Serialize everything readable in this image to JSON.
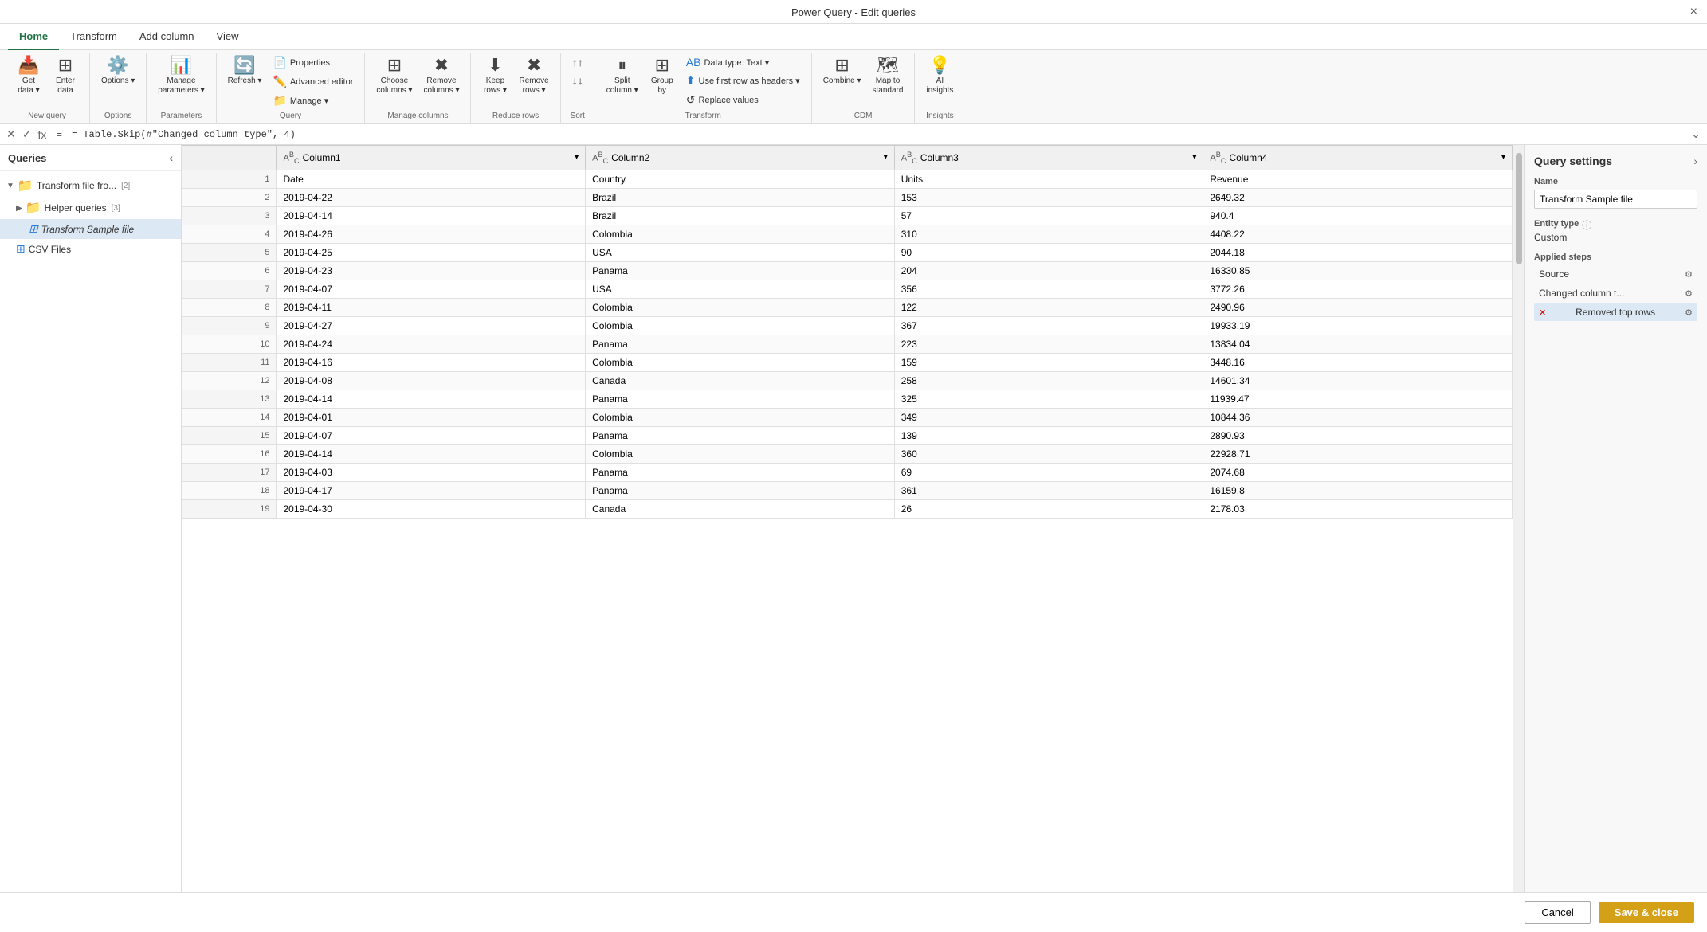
{
  "window": {
    "title": "Power Query - Edit queries",
    "close_label": "×"
  },
  "ribbon": {
    "tabs": [
      {
        "id": "home",
        "label": "Home",
        "active": true
      },
      {
        "id": "transform",
        "label": "Transform"
      },
      {
        "id": "add_column",
        "label": "Add column"
      },
      {
        "id": "view",
        "label": "View"
      }
    ],
    "groups": {
      "new_query": {
        "label": "New query",
        "buttons": [
          {
            "id": "get_data",
            "label": "Get\ndata",
            "icon": "📥"
          },
          {
            "id": "enter_data",
            "label": "Enter\ndata",
            "icon": "📋"
          }
        ]
      },
      "options": {
        "label": "Options",
        "buttons": [
          {
            "id": "options",
            "label": "Options",
            "icon": "⚙️"
          }
        ]
      },
      "parameters": {
        "label": "Parameters",
        "buttons": [
          {
            "id": "manage_parameters",
            "label": "Manage\nparameters",
            "icon": "📊"
          }
        ]
      },
      "query": {
        "label": "Query",
        "small_buttons": [
          {
            "id": "properties",
            "label": "Properties",
            "icon": "📄"
          },
          {
            "id": "advanced_editor",
            "label": "Advanced editor",
            "icon": "✏️"
          },
          {
            "id": "manage",
            "label": "Manage",
            "icon": "📁"
          }
        ],
        "buttons": [
          {
            "id": "refresh",
            "label": "Refresh",
            "icon": "🔄"
          }
        ]
      },
      "manage_columns": {
        "label": "Manage columns",
        "buttons": [
          {
            "id": "choose_columns",
            "label": "Choose\ncolumns",
            "icon": "⊞"
          },
          {
            "id": "remove_columns",
            "label": "Remove\ncolumns",
            "icon": "✖"
          }
        ]
      },
      "reduce_rows": {
        "label": "Reduce rows",
        "buttons": [
          {
            "id": "keep_rows",
            "label": "Keep\nrows",
            "icon": "⬇"
          },
          {
            "id": "remove_rows",
            "label": "Remove\nrows",
            "icon": "✖"
          }
        ]
      },
      "sort": {
        "label": "Sort",
        "buttons": [
          {
            "id": "sort_asc",
            "label": "",
            "icon": "↑"
          },
          {
            "id": "sort_desc",
            "label": "",
            "icon": "↓"
          }
        ]
      },
      "transform": {
        "label": "Transform",
        "buttons": [
          {
            "id": "split_column",
            "label": "Split\ncolumn",
            "icon": "⏸"
          },
          {
            "id": "group_by",
            "label": "Group\nby",
            "icon": "⊞"
          }
        ],
        "small_buttons": [
          {
            "id": "data_type",
            "label": "Data type: Text",
            "icon": "AB"
          },
          {
            "id": "use_first_row",
            "label": "Use first row as headers",
            "icon": "⬆"
          },
          {
            "id": "replace_values",
            "label": "Replace values",
            "icon": "↺"
          }
        ]
      },
      "cdm": {
        "label": "CDM",
        "buttons": [
          {
            "id": "combine",
            "label": "Combine",
            "icon": "⊞"
          },
          {
            "id": "map_to_standard",
            "label": "Map to\nstandard",
            "icon": "🗺"
          }
        ]
      },
      "insights": {
        "label": "Insights",
        "buttons": [
          {
            "id": "ai_insights",
            "label": "AI\ninsights",
            "icon": "💡"
          }
        ]
      }
    }
  },
  "formula_bar": {
    "formula": "= Table.Skip(#\"Changed column type\", 4)",
    "placeholder": "Enter formula"
  },
  "queries_panel": {
    "title": "Queries",
    "items": [
      {
        "id": "transform_file_fro",
        "label": "Transform file fro...",
        "type": "folder",
        "badge": "[2]",
        "expanded": true,
        "indent": 0
      },
      {
        "id": "helper_queries",
        "label": "Helper queries",
        "type": "folder",
        "badge": "[3]",
        "expanded": false,
        "indent": 1
      },
      {
        "id": "transform_sample_file",
        "label": "Transform Sample file",
        "type": "table",
        "badge": "",
        "expanded": false,
        "indent": 2,
        "selected": true,
        "italic": true
      },
      {
        "id": "csv_files",
        "label": "CSV Files",
        "type": "table",
        "badge": "",
        "expanded": false,
        "indent": 1
      }
    ]
  },
  "data_grid": {
    "columns": [
      {
        "id": "col1",
        "type": "ABC",
        "name": "Column1"
      },
      {
        "id": "col2",
        "type": "ABC",
        "name": "Column2"
      },
      {
        "id": "col3",
        "type": "ABC",
        "name": "Column3"
      },
      {
        "id": "col4",
        "type": "ABC",
        "name": "Column4"
      }
    ],
    "rows": [
      {
        "num": 1,
        "col1": "Date",
        "col2": "Country",
        "col3": "Units",
        "col4": "Revenue"
      },
      {
        "num": 2,
        "col1": "2019-04-22",
        "col2": "Brazil",
        "col3": "153",
        "col4": "2649.32"
      },
      {
        "num": 3,
        "col1": "2019-04-14",
        "col2": "Brazil",
        "col3": "57",
        "col4": "940.4"
      },
      {
        "num": 4,
        "col1": "2019-04-26",
        "col2": "Colombia",
        "col3": "310",
        "col4": "4408.22"
      },
      {
        "num": 5,
        "col1": "2019-04-25",
        "col2": "USA",
        "col3": "90",
        "col4": "2044.18"
      },
      {
        "num": 6,
        "col1": "2019-04-23",
        "col2": "Panama",
        "col3": "204",
        "col4": "16330.85"
      },
      {
        "num": 7,
        "col1": "2019-04-07",
        "col2": "USA",
        "col3": "356",
        "col4": "3772.26"
      },
      {
        "num": 8,
        "col1": "2019-04-11",
        "col2": "Colombia",
        "col3": "122",
        "col4": "2490.96"
      },
      {
        "num": 9,
        "col1": "2019-04-27",
        "col2": "Colombia",
        "col3": "367",
        "col4": "19933.19"
      },
      {
        "num": 10,
        "col1": "2019-04-24",
        "col2": "Panama",
        "col3": "223",
        "col4": "13834.04"
      },
      {
        "num": 11,
        "col1": "2019-04-16",
        "col2": "Colombia",
        "col3": "159",
        "col4": "3448.16"
      },
      {
        "num": 12,
        "col1": "2019-04-08",
        "col2": "Canada",
        "col3": "258",
        "col4": "14601.34"
      },
      {
        "num": 13,
        "col1": "2019-04-14",
        "col2": "Panama",
        "col3": "325",
        "col4": "11939.47"
      },
      {
        "num": 14,
        "col1": "2019-04-01",
        "col2": "Colombia",
        "col3": "349",
        "col4": "10844.36"
      },
      {
        "num": 15,
        "col1": "2019-04-07",
        "col2": "Panama",
        "col3": "139",
        "col4": "2890.93"
      },
      {
        "num": 16,
        "col1": "2019-04-14",
        "col2": "Colombia",
        "col3": "360",
        "col4": "22928.71"
      },
      {
        "num": 17,
        "col1": "2019-04-03",
        "col2": "Panama",
        "col3": "69",
        "col4": "2074.68"
      },
      {
        "num": 18,
        "col1": "2019-04-17",
        "col2": "Panama",
        "col3": "361",
        "col4": "16159.8"
      },
      {
        "num": 19,
        "col1": "2019-04-30",
        "col2": "Canada",
        "col3": "26",
        "col4": "2178.03"
      }
    ]
  },
  "query_settings": {
    "title": "Query settings",
    "name_label": "Name",
    "name_value": "Transform Sample file",
    "entity_type_label": "Entity type",
    "entity_type_value": "Custom",
    "applied_steps_label": "Applied steps",
    "steps": [
      {
        "id": "source",
        "label": "Source",
        "active": false
      },
      {
        "id": "changed_column_t",
        "label": "Changed column t...",
        "active": false
      },
      {
        "id": "removed_top_rows",
        "label": "Removed top rows",
        "active": true,
        "has_remove": true
      }
    ]
  },
  "footer": {
    "cancel_label": "Cancel",
    "save_label": "Save & close"
  }
}
